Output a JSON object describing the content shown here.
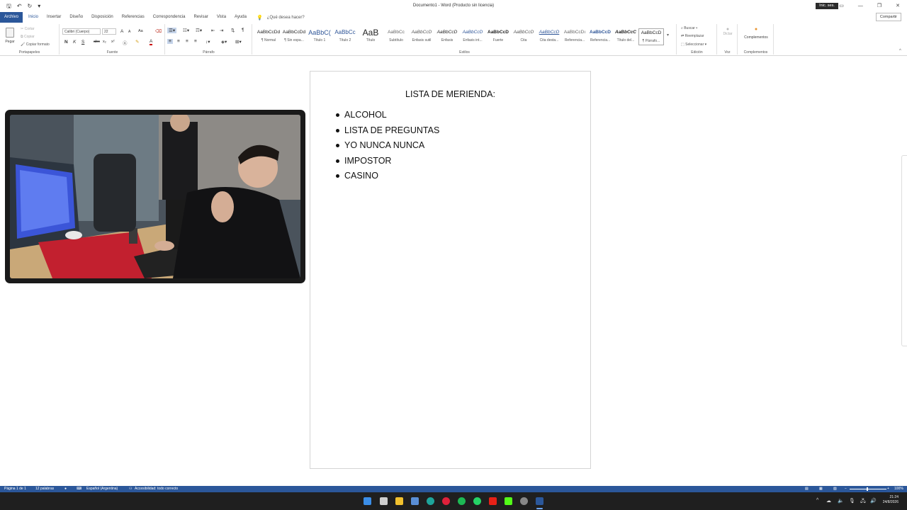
{
  "titlebar": {
    "doc_title": "Documento1 - Word (Producto sin licencia)",
    "login_label": "Inic. ses.",
    "qat_save": "🖫",
    "qat_undo": "↶",
    "qat_redo": "↻"
  },
  "tabs": [
    {
      "label": "Archivo"
    },
    {
      "label": "Inicio"
    },
    {
      "label": "Insertar"
    },
    {
      "label": "Diseño"
    },
    {
      "label": "Disposición"
    },
    {
      "label": "Referencias"
    },
    {
      "label": "Correspondencia"
    },
    {
      "label": "Revisar"
    },
    {
      "label": "Vista"
    },
    {
      "label": "Ayuda"
    }
  ],
  "tell_me": "¿Qué desea hacer?",
  "share_label": "Compartir",
  "ribbon": {
    "clipboard": {
      "paste": "Pegar",
      "cut": "Cortar",
      "copy": "Copiar",
      "format_painter": "Copiar formato",
      "label": "Portapapeles"
    },
    "font": {
      "family": "Calibri (Cuerpo)",
      "size": "22",
      "bold": "N",
      "italic": "K",
      "underline": "S",
      "strike": "abc",
      "subscript": "x₂",
      "superscript": "x²",
      "grow": "A",
      "shrink": "A",
      "case": "Aa",
      "color": "A",
      "label": "Fuente"
    },
    "paragraph": {
      "label": "Párrafo",
      "pilcrow": "¶"
    },
    "styles": {
      "label": "Estilos",
      "items": [
        {
          "preview": "AaBbCcDd",
          "name": "¶ Normal"
        },
        {
          "preview": "AaBbCcDd",
          "name": "¶ Sin espa..."
        },
        {
          "preview": "AaBbC(",
          "name": "Título 1"
        },
        {
          "preview": "AaBbCc",
          "name": "Título 2"
        },
        {
          "preview": "AaB",
          "name": "Título"
        },
        {
          "preview": "AaBbCc",
          "name": "Subtítulo"
        },
        {
          "preview": "AaBbCcD",
          "name": "Énfasis sutil"
        },
        {
          "preview": "AaBbCcD",
          "name": "Énfasis"
        },
        {
          "preview": "AaBbCcD",
          "name": "Énfasis int..."
        },
        {
          "preview": "AaBbCcD",
          "name": "Fuerte"
        },
        {
          "preview": "AaBbCcD",
          "name": "Cita"
        },
        {
          "preview": "AaBbCcD",
          "name": "Cita desta..."
        },
        {
          "preview": "AaBbCcDı",
          "name": "Referencia..."
        },
        {
          "preview": "AaBbCcD",
          "name": "Referencia..."
        },
        {
          "preview": "AaBbCcC",
          "name": "Título del..."
        },
        {
          "preview": "AaBbCcD",
          "name": "¶ Párrafo..."
        }
      ]
    },
    "editing": {
      "find": "Buscar",
      "replace": "Reemplazar",
      "select": "Seleccionar",
      "label": "Edición"
    },
    "voice": {
      "dictate": "Dictar",
      "label": "Voz"
    },
    "addins": {
      "button": "Complementos",
      "label": "Complementos"
    }
  },
  "document": {
    "title": "LISTA DE MERIENDA:",
    "items": [
      "ALCOHOL",
      "LISTA DE PREGUNTAS",
      "YO NUNCA NUNCA",
      "IMPOSTOR",
      "CASINO"
    ]
  },
  "status": {
    "page": "Página 1 de 1",
    "words": "12 palabras",
    "language": "Español (Argentina)",
    "accessibility": "Accesibilidad: todo correcto",
    "zoom": "100%"
  },
  "taskbar": {
    "time": "21:24",
    "date": "24/8/2026"
  },
  "colors": {
    "accent": "#2b579a",
    "taskbar": "#1f1f1f"
  }
}
